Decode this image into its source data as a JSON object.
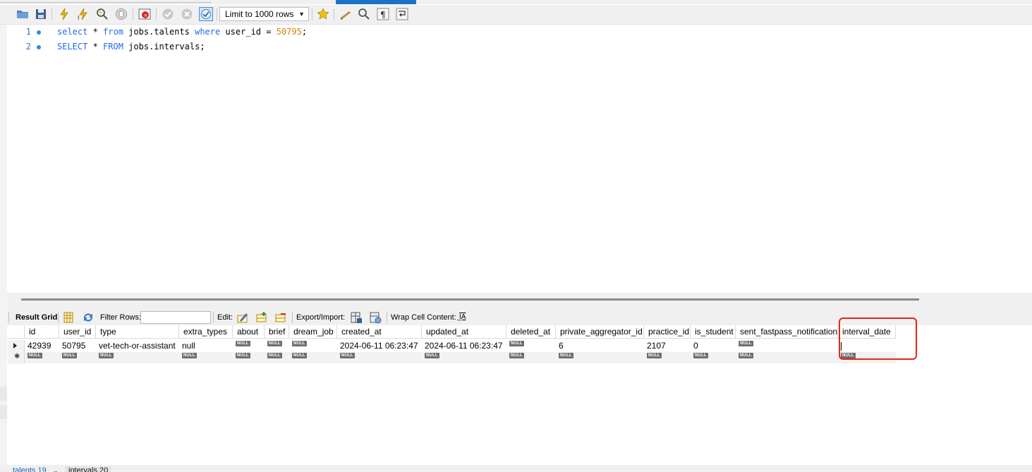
{
  "toolbar": {
    "limit_select_value": "Limit to 1000 rows",
    "buttons": [
      "open-folder-icon",
      "save-icon",
      "execute-icon",
      "execute-current-icon",
      "explain-icon",
      "stop-icon",
      "toggle-error-icon",
      "commit-icon",
      "rollback-icon",
      "autocommit-icon",
      "bookmark-star-icon",
      "beautify-icon",
      "find-icon",
      "invisible-chars-icon",
      "wrap-icon"
    ]
  },
  "editor": {
    "lines": [
      {
        "number": "1",
        "parts": [
          {
            "t": "select",
            "c": "kw"
          },
          {
            "t": " * ",
            "c": ""
          },
          {
            "t": "from",
            "c": "kw"
          },
          {
            "t": " jobs.talents ",
            "c": ""
          },
          {
            "t": "where",
            "c": "kw"
          },
          {
            "t": " user_id = ",
            "c": ""
          },
          {
            "t": "50795",
            "c": "num"
          },
          {
            "t": ";",
            "c": ""
          }
        ]
      },
      {
        "number": "2",
        "parts": [
          {
            "t": "SELECT",
            "c": "kw"
          },
          {
            "t": " * ",
            "c": ""
          },
          {
            "t": "FROM",
            "c": "kw"
          },
          {
            "t": " jobs.intervals;",
            "c": ""
          }
        ]
      }
    ]
  },
  "result_toolbar": {
    "result_grid_label": "Result Grid",
    "filter_rows_label": "Filter Rows:",
    "edit_label": "Edit:",
    "export_label": "Export/Import:",
    "wrap_label": "Wrap Cell Content:",
    "wrap_icon_text": "̲IA"
  },
  "grid": {
    "null_text": "NULL",
    "columns": [
      "id",
      "user_id",
      "type",
      "extra_types",
      "about",
      "brief",
      "dream_job",
      "created_at",
      "updated_at",
      "deleted_at",
      "private_aggregator_id",
      "practice_id",
      "is_student",
      "sent_fastpass_notification",
      "interval_date"
    ],
    "rows": [
      [
        "42939",
        "50795",
        "vet-tech-or-assistant",
        "null",
        null,
        null,
        null,
        "2024-06-11 06:23:47",
        "2024-06-11 06:23:47",
        null,
        "6",
        "2107",
        "0",
        null,
        ""
      ]
    ]
  },
  "bottom_tabs": [
    {
      "label": "talents 19"
    },
    {
      "label": "intervals 20"
    }
  ],
  "colors": {
    "keyword": "#1e6ee8",
    "number": "#d4820b",
    "line_number": "#3074c4",
    "highlight": "#e8231f"
  }
}
